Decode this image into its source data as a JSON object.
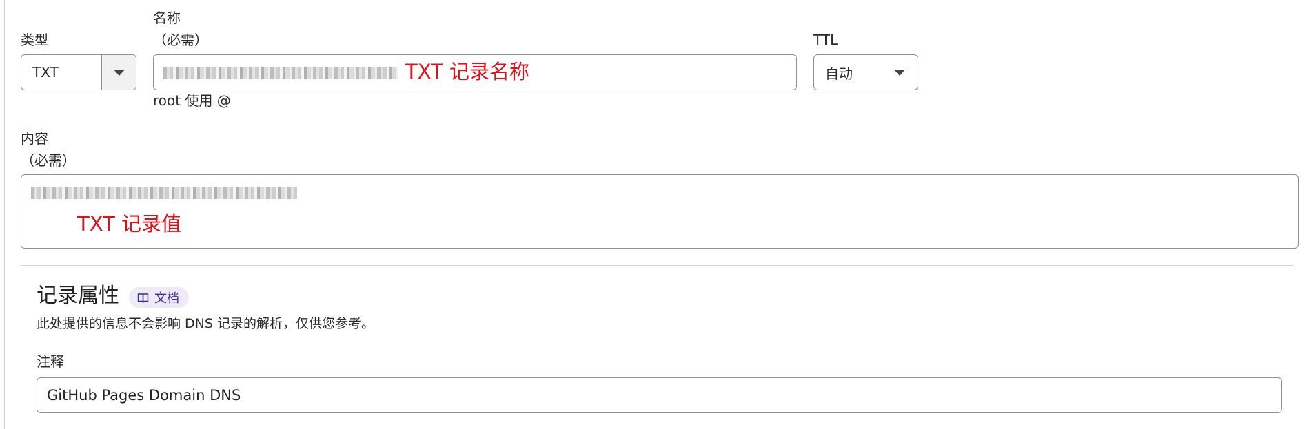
{
  "type_field": {
    "label": "类型",
    "selected": "TXT"
  },
  "name_field": {
    "label": "名称",
    "required": "（必需）",
    "help": "root 使用 @",
    "annotation": "TXT 记录名称"
  },
  "ttl_field": {
    "label": "TTL",
    "selected": "自动"
  },
  "content_field": {
    "label": "内容",
    "required": "（必需）",
    "annotation": "TXT 记录值"
  },
  "record_attributes": {
    "title": "记录属性",
    "doc_badge": "文档",
    "description": "此处提供的信息不会影响 DNS 记录的解析，仅供您参考。"
  },
  "comment_field": {
    "label": "注释",
    "value": "GitHub Pages Domain DNS"
  },
  "colors": {
    "annotation_red": "#e0101a",
    "border": "#8f8f8f",
    "badge_bg": "#eeeaf8",
    "badge_text": "#3d2d8a"
  },
  "icons": {
    "dropdown": "caret-down-icon",
    "doc": "book-icon"
  }
}
